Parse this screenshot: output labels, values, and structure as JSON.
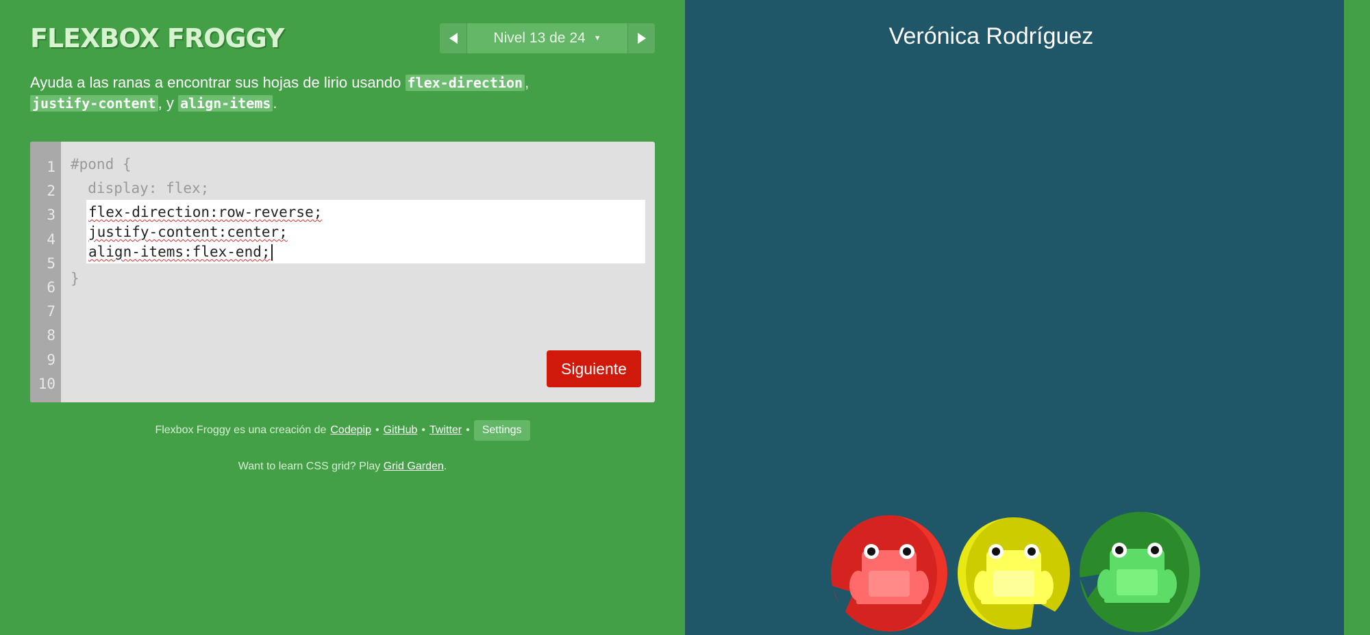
{
  "header": {
    "logo": "FLEXBOX FROGGY",
    "level_label": "Nivel 13 de 24",
    "prev_icon": "triangle-left-icon",
    "next_icon": "triangle-right-icon"
  },
  "instructions": {
    "prefix": "Ayuda a las ranas a encontrar sus hojas de lirio usando ",
    "prop_1": "flex-direction",
    "sep_1": ",",
    "prop_2": "justify-content",
    "sep_2": ", y ",
    "prop_3": "align-items",
    "suffix": "."
  },
  "editor": {
    "line_numbers": [
      "1",
      "2",
      "3",
      "4",
      "5",
      "6",
      "7",
      "8",
      "9",
      "10"
    ],
    "line_1": "#pond {",
    "line_2": "  display: flex;",
    "input_lines": [
      "flex-direction:row-reverse;",
      "justify-content:center;",
      "align-items:flex-end;"
    ],
    "line_6": "}",
    "next_button": "Siguiente"
  },
  "footer": {
    "credit_prefix": "Flexbox Froggy es una creación de",
    "link_codepip": "Codepip",
    "link_github": "GitHub",
    "link_twitter": "Twitter",
    "separator": "•",
    "settings": "Settings",
    "promo_prefix": "Want to learn CSS grid? Play",
    "promo_link": "Grid Garden",
    "promo_suffix": "."
  },
  "pond": {
    "owner": "Verónica Rodríguez",
    "frogs": [
      {
        "color": "red",
        "pad_color": "#d52420",
        "pad_shade": "#ff3d30",
        "body": "#ff6b6b",
        "belly": "#ff8a88"
      },
      {
        "color": "yellow",
        "pad_color": "#cccc00",
        "pad_shade": "#f0ef16",
        "body": "#ffff5a",
        "belly": "#ffff99"
      },
      {
        "color": "green",
        "pad_color": "#2b8a2a",
        "pad_shade": "#44a845",
        "body": "#5ddc68",
        "belly": "#7cf27e"
      }
    ]
  }
}
